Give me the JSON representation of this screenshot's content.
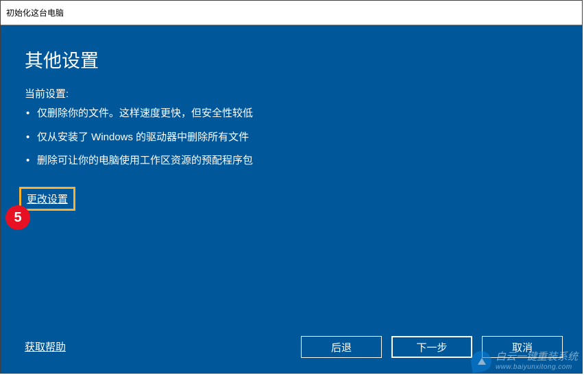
{
  "window": {
    "title": "初始化这台电脑"
  },
  "content": {
    "heading": "其他设置",
    "current_settings_label": "当前设置:",
    "bullets": [
      "仅删除你的文件。这样速度更快，但安全性较低",
      "仅从安装了 Windows 的驱动器中删除所有文件",
      "删除可让你的电脑使用工作区资源的预配程序包"
    ],
    "change_settings": "更改设置",
    "help_link": "获取帮助"
  },
  "buttons": {
    "back": "后退",
    "next": "下一步",
    "cancel": "取消"
  },
  "annotation": {
    "badge": "5"
  },
  "watermark": {
    "cn": "白云一键重装系统",
    "url": "www.baiyunxitong.com"
  }
}
